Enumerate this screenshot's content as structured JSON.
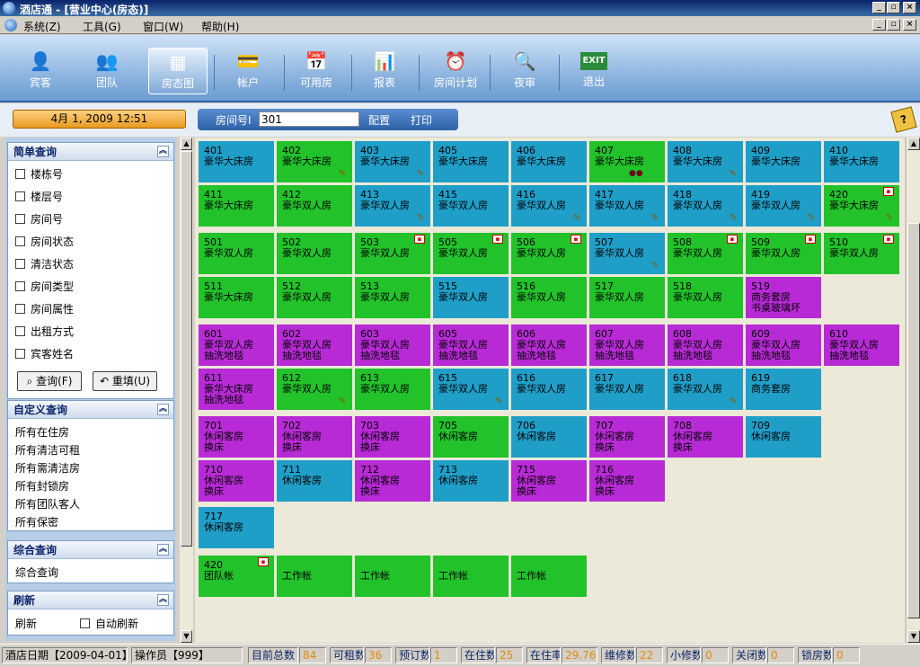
{
  "window": {
    "title": "酒店通 - [营业中心(房态)]"
  },
  "menu": [
    "系统(Z)",
    "工具(G)",
    "窗口(W)",
    "帮助(H)"
  ],
  "toolbar": [
    {
      "label": "宾客",
      "icon": "guest-icon"
    },
    {
      "label": "团队",
      "icon": "team-icon"
    },
    {
      "label": "房态图",
      "icon": "room-status-icon",
      "selected": true
    },
    {
      "label": "帐户",
      "icon": "account-icon"
    },
    {
      "label": "可用房",
      "icon": "available-room-icon"
    },
    {
      "label": "报表",
      "icon": "report-icon"
    },
    {
      "label": "房间计划",
      "icon": "room-plan-icon"
    },
    {
      "label": "夜审",
      "icon": "night-audit-icon"
    },
    {
      "label": "退出",
      "icon": "exit-icon"
    }
  ],
  "datetime": "4月 1, 2009  12:51",
  "room_search": {
    "label": "房间号I",
    "value": "301",
    "config": "配置",
    "print": "打印"
  },
  "sidebar": {
    "simple": {
      "title": "简单查询",
      "items": [
        "楼栋号",
        "楼层号",
        "房间号",
        "房间状态",
        "清洁状态",
        "房间类型",
        "房间属性",
        "出租方式",
        "宾客姓名"
      ],
      "query": "查询(F)",
      "reset": "重填(U)"
    },
    "custom": {
      "title": "自定义查询",
      "items": [
        "所有在住房",
        "所有清洁可租",
        "所有需清洁房",
        "所有封锁房",
        "所有团队客人",
        "所有保密"
      ]
    },
    "combined": {
      "title": "综合查询",
      "items": [
        "综合查询"
      ]
    },
    "refresh": {
      "title": "刷新",
      "label": "刷新",
      "auto": "自动刷新"
    }
  },
  "rooms": [
    {
      "num": "401",
      "type": "豪华大床房",
      "color": "blue"
    },
    {
      "num": "402",
      "type": "豪华大床房",
      "color": "green",
      "brush": true
    },
    {
      "num": "403",
      "type": "豪华大床房",
      "color": "blue",
      "brush": true
    },
    {
      "num": "405",
      "type": "豪华大床房",
      "color": "blue"
    },
    {
      "num": "406",
      "type": "豪华大床房",
      "color": "blue"
    },
    {
      "num": "407",
      "type": "豪华大床房",
      "color": "green",
      "car": true
    },
    {
      "num": "408",
      "type": "豪华大床房",
      "color": "blue",
      "brush": true
    },
    {
      "num": "409",
      "type": "豪华大床房",
      "color": "blue"
    },
    {
      "num": "410",
      "type": "豪华大床房",
      "color": "blue"
    },
    {
      "num": "411",
      "type": "豪华大床房",
      "color": "green"
    },
    {
      "num": "412",
      "type": "豪华双人房",
      "color": "green"
    },
    {
      "num": "413",
      "type": "豪华双人房",
      "color": "blue",
      "brush": true
    },
    {
      "num": "415",
      "type": "豪华双人房",
      "color": "blue"
    },
    {
      "num": "416",
      "type": "豪华双人房",
      "color": "blue",
      "brush": true
    },
    {
      "num": "417",
      "type": "豪华双人房",
      "color": "blue",
      "brush": true
    },
    {
      "num": "418",
      "type": "豪华双人房",
      "color": "blue",
      "brush": true
    },
    {
      "num": "419",
      "type": "豪华双人房",
      "color": "blue",
      "brush": true
    },
    {
      "num": "420",
      "type": "豪华大床房",
      "color": "green",
      "flag": true,
      "brush": true
    },
    {
      "num": "501",
      "type": "豪华双人房",
      "color": "green"
    },
    {
      "num": "502",
      "type": "豪华双人房",
      "color": "green"
    },
    {
      "num": "503",
      "type": "豪华双人房",
      "color": "green",
      "flag": true
    },
    {
      "num": "505",
      "type": "豪华双人房",
      "color": "green",
      "flag": true
    },
    {
      "num": "506",
      "type": "豪华双人房",
      "color": "green",
      "flag": true
    },
    {
      "num": "507",
      "type": "豪华双人房",
      "color": "blue",
      "brush": true
    },
    {
      "num": "508",
      "type": "豪华双人房",
      "color": "green",
      "flag": true
    },
    {
      "num": "509",
      "type": "豪华双人房",
      "color": "green",
      "flag": true
    },
    {
      "num": "510",
      "type": "豪华双人房",
      "color": "green",
      "flag": true
    },
    {
      "num": "511",
      "type": "豪华大床房",
      "color": "green"
    },
    {
      "num": "512",
      "type": "豪华双人房",
      "color": "green"
    },
    {
      "num": "513",
      "type": "豪华双人房",
      "color": "green"
    },
    {
      "num": "515",
      "type": "豪华双人房",
      "color": "blue"
    },
    {
      "num": "516",
      "type": "豪华双人房",
      "color": "green"
    },
    {
      "num": "517",
      "type": "豪华双人房",
      "color": "green"
    },
    {
      "num": "518",
      "type": "豪华双人房",
      "color": "green"
    },
    {
      "num": "519",
      "type": "商务套房",
      "note": "书桌玻璃坏",
      "color": "purple"
    },
    {
      "num": "601",
      "type": "豪华双人房",
      "note": "抽洗地毯",
      "color": "purple"
    },
    {
      "num": "602",
      "type": "豪华双人房",
      "note": "抽洗地毯",
      "color": "purple"
    },
    {
      "num": "603",
      "type": "豪华双人房",
      "note": "抽洗地毯",
      "color": "purple"
    },
    {
      "num": "605",
      "type": "豪华双人房",
      "note": "抽洗地毯",
      "color": "purple"
    },
    {
      "num": "606",
      "type": "豪华双人房",
      "note": "抽洗地毯",
      "color": "purple"
    },
    {
      "num": "607",
      "type": "豪华双人房",
      "note": "抽洗地毯",
      "color": "purple"
    },
    {
      "num": "608",
      "type": "豪华双人房",
      "note": "抽洗地毯",
      "color": "purple"
    },
    {
      "num": "609",
      "type": "豪华双人房",
      "note": "抽洗地毯",
      "color": "purple"
    },
    {
      "num": "610",
      "type": "豪华双人房",
      "note": "抽洗地毯",
      "color": "purple"
    },
    {
      "num": "611",
      "type": "豪华大床房",
      "note": "抽洗地毯",
      "color": "purple"
    },
    {
      "num": "612",
      "type": "豪华双人房",
      "color": "green",
      "brush": true
    },
    {
      "num": "613",
      "type": "豪华双人房",
      "color": "green"
    },
    {
      "num": "615",
      "type": "豪华双人房",
      "color": "blue",
      "brush": true
    },
    {
      "num": "616",
      "type": "豪华双人房",
      "color": "blue"
    },
    {
      "num": "617",
      "type": "豪华双人房",
      "color": "blue"
    },
    {
      "num": "618",
      "type": "豪华双人房",
      "color": "blue",
      "brush": true
    },
    {
      "num": "619",
      "type": "商务套房",
      "color": "blue"
    },
    {
      "num": "701",
      "type": "休闲客房",
      "note": "换床",
      "color": "purple"
    },
    {
      "num": "702",
      "type": "休闲客房",
      "note": "换床",
      "color": "purple"
    },
    {
      "num": "703",
      "type": "休闲客房",
      "note": "换床",
      "color": "purple"
    },
    {
      "num": "705",
      "type": "休闲客房",
      "color": "green"
    },
    {
      "num": "706",
      "type": "休闲客房",
      "color": "blue"
    },
    {
      "num": "707",
      "type": "休闲客房",
      "note": "换床",
      "color": "purple"
    },
    {
      "num": "708",
      "type": "休闲客房",
      "note": "换床",
      "color": "purple"
    },
    {
      "num": "709",
      "type": "休闲客房",
      "color": "blue"
    },
    {
      "num": "710",
      "type": "休闲客房",
      "note": "换床",
      "color": "purple"
    },
    {
      "num": "711",
      "type": "休闲客房",
      "color": "blue"
    },
    {
      "num": "712",
      "type": "休闲客房",
      "note": "换床",
      "color": "purple"
    },
    {
      "num": "713",
      "type": "休闲客房",
      "color": "blue"
    },
    {
      "num": "715",
      "type": "休闲客房",
      "note": "换床",
      "color": "purple"
    },
    {
      "num": "716",
      "type": "休闲客房",
      "note": "换床",
      "color": "purple"
    },
    {
      "num": "717",
      "type": "休闲客房",
      "color": "blue"
    },
    {
      "num": "420",
      "type": "团队帐",
      "color": "green",
      "flag": true
    },
    {
      "num": "",
      "type": "工作帐",
      "color": "green"
    },
    {
      "num": "",
      "type": "工作帐",
      "color": "green"
    },
    {
      "num": "",
      "type": "工作帐",
      "color": "green"
    },
    {
      "num": "",
      "type": "工作帐",
      "color": "green"
    },
    {
      "num": "",
      "type": "工作帐",
      "color": "green"
    }
  ],
  "colors": {
    "green": "#22c22a",
    "blue": "#1f9ec8",
    "purple": "#b82ad6"
  },
  "status": {
    "hotel_date": "酒店日期【2009-04-01】",
    "operator": "操作员【999】",
    "stats": [
      {
        "label": "目前总数",
        "value": "84"
      },
      {
        "label": "可租数",
        "value": "36"
      },
      {
        "label": "预订数",
        "value": "1"
      },
      {
        "label": "在住数",
        "value": "25"
      },
      {
        "label": "在住率",
        "value": "29.76%"
      },
      {
        "label": "维修数",
        "value": "22"
      },
      {
        "label": "小修数",
        "value": "0"
      },
      {
        "label": "关闭数",
        "value": "0"
      },
      {
        "label": "锁房数",
        "value": "0"
      }
    ]
  }
}
